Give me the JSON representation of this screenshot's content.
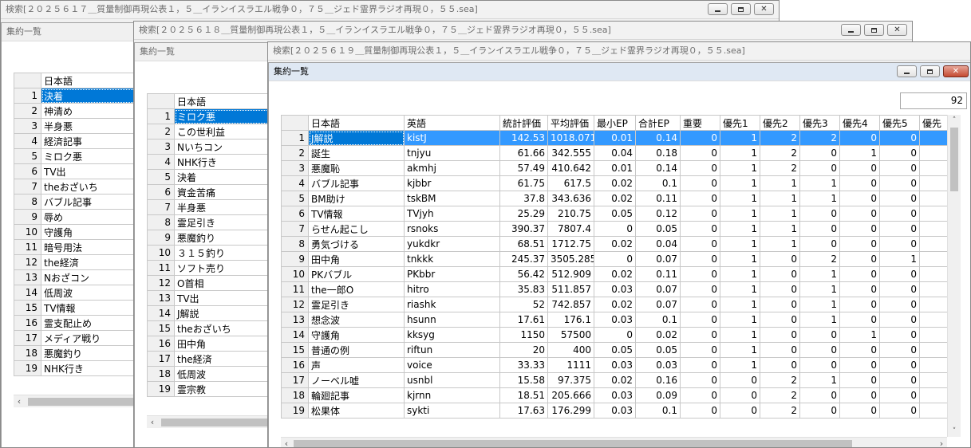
{
  "windows": [
    {
      "title": "検索[２０２５６１７＿質量制御再現公表１，５＿イランイスラエル戦争０，７５＿ジェド霊界ラジオ再現０，５５.sea]",
      "subtitle": "集約一覧",
      "header": "日本語",
      "rows": [
        "決着",
        "神清め",
        "半身悪",
        "経済記事",
        "ミロク悪",
        "TV出",
        "theおざいち",
        "バブル記事",
        "辱め",
        "守護角",
        "暗号用法",
        "the経済",
        "Nおざコン",
        "低周波",
        "TV情報",
        "霊支配止め",
        "メディア戦り",
        "悪魔釣り",
        "NHK行き"
      ]
    },
    {
      "title": "検索[２０２５６１８＿質量制御再現公表１，５＿イランイスラエル戦争０，７５＿ジェド霊界ラジオ再現０，５５.sea]",
      "subtitle": "集約一覧",
      "header": "日本語",
      "rows": [
        "ミロク悪",
        "この世利益",
        "Nいちコン",
        "NHK行き",
        "決着",
        "資金苦痛",
        "半身悪",
        "霊足引き",
        "悪魔釣り",
        "３１５釣り",
        "ソフト売り",
        "O首相",
        "TV出",
        "J解説",
        "theおざいち",
        "田中角",
        "the経済",
        "低周波",
        "霊宗教"
      ]
    },
    {
      "title": "検索[２０２５６１９＿質量制御再現公表１，５＿イランイスラエル戦争０，７５＿ジェド霊界ラジオ再現０，５５.sea]",
      "subtitle": "集約一覧",
      "count": "92",
      "headers": [
        "日本語",
        "英語",
        "統計評価",
        "平均評価",
        "最小EP",
        "合計EP",
        "重要",
        "優先1",
        "優先2",
        "優先3",
        "優先4",
        "優先5",
        "優先"
      ],
      "rows": [
        [
          "J解説",
          "kistJ",
          "142.53",
          "1018.071",
          "0.01",
          "0.14",
          "0",
          "1",
          "2",
          "2",
          "0",
          "0"
        ],
        [
          "誕生",
          "tnjyu",
          "61.66",
          "342.555",
          "0.04",
          "0.18",
          "0",
          "1",
          "2",
          "0",
          "1",
          "0"
        ],
        [
          "悪魔恥",
          "akmhj",
          "57.49",
          "410.642",
          "0.01",
          "0.14",
          "0",
          "1",
          "2",
          "0",
          "0",
          "0"
        ],
        [
          "バブル記事",
          "kjbbr",
          "61.75",
          "617.5",
          "0.02",
          "0.1",
          "0",
          "1",
          "1",
          "1",
          "0",
          "0"
        ],
        [
          "BM助け",
          "tskBM",
          "37.8",
          "343.636",
          "0.02",
          "0.11",
          "0",
          "1",
          "1",
          "1",
          "0",
          "0"
        ],
        [
          "TV情報",
          "TVjyh",
          "25.29",
          "210.75",
          "0.05",
          "0.12",
          "0",
          "1",
          "1",
          "0",
          "0",
          "0"
        ],
        [
          "らせん起こし",
          "rsnoks",
          "390.37",
          "7807.4",
          "0",
          "0.05",
          "0",
          "1",
          "1",
          "0",
          "0",
          "0"
        ],
        [
          "勇気づける",
          "yukdkr",
          "68.51",
          "1712.75",
          "0.02",
          "0.04",
          "0",
          "1",
          "1",
          "0",
          "0",
          "0"
        ],
        [
          "田中角",
          "tnkkk",
          "245.37",
          "3505.285",
          "0",
          "0.07",
          "0",
          "1",
          "0",
          "2",
          "0",
          "1"
        ],
        [
          "PKバブル",
          "PKbbr",
          "56.42",
          "512.909",
          "0.02",
          "0.11",
          "0",
          "1",
          "0",
          "1",
          "0",
          "0"
        ],
        [
          "the一郎O",
          "hitro",
          "35.83",
          "511.857",
          "0.03",
          "0.07",
          "0",
          "1",
          "0",
          "1",
          "0",
          "0"
        ],
        [
          "霊足引き",
          "riashk",
          "52",
          "742.857",
          "0.02",
          "0.07",
          "0",
          "1",
          "0",
          "1",
          "0",
          "0"
        ],
        [
          "想念波",
          "hsunn",
          "17.61",
          "176.1",
          "0.03",
          "0.1",
          "0",
          "1",
          "0",
          "1",
          "0",
          "0"
        ],
        [
          "守護角",
          "kksyg",
          "1150",
          "57500",
          "0",
          "0.02",
          "0",
          "1",
          "0",
          "0",
          "1",
          "0"
        ],
        [
          "普通の例",
          "riftun",
          "20",
          "400",
          "0.05",
          "0.05",
          "0",
          "1",
          "0",
          "0",
          "0",
          "0"
        ],
        [
          "声",
          "voice",
          "33.33",
          "1111",
          "0.03",
          "0.03",
          "0",
          "1",
          "0",
          "0",
          "0",
          "0"
        ],
        [
          "ノーベル嘘",
          "usnbl",
          "15.58",
          "97.375",
          "0.02",
          "0.16",
          "0",
          "0",
          "2",
          "1",
          "0",
          "0"
        ],
        [
          "輪廻記事",
          "kjrnn",
          "18.51",
          "205.666",
          "0.03",
          "0.09",
          "0",
          "0",
          "2",
          "0",
          "0",
          "0"
        ],
        [
          "松果体",
          "sykti",
          "17.63",
          "176.299",
          "0.03",
          "0.1",
          "0",
          "0",
          "2",
          "0",
          "0",
          "0"
        ]
      ]
    }
  ],
  "icons": {
    "minimize": "minimize-icon",
    "maximize": "maximize-icon",
    "close": "close-icon"
  },
  "glyphs": {
    "close": "✕",
    "left": "‹",
    "right": "›",
    "up": "˄",
    "down": "˅"
  }
}
